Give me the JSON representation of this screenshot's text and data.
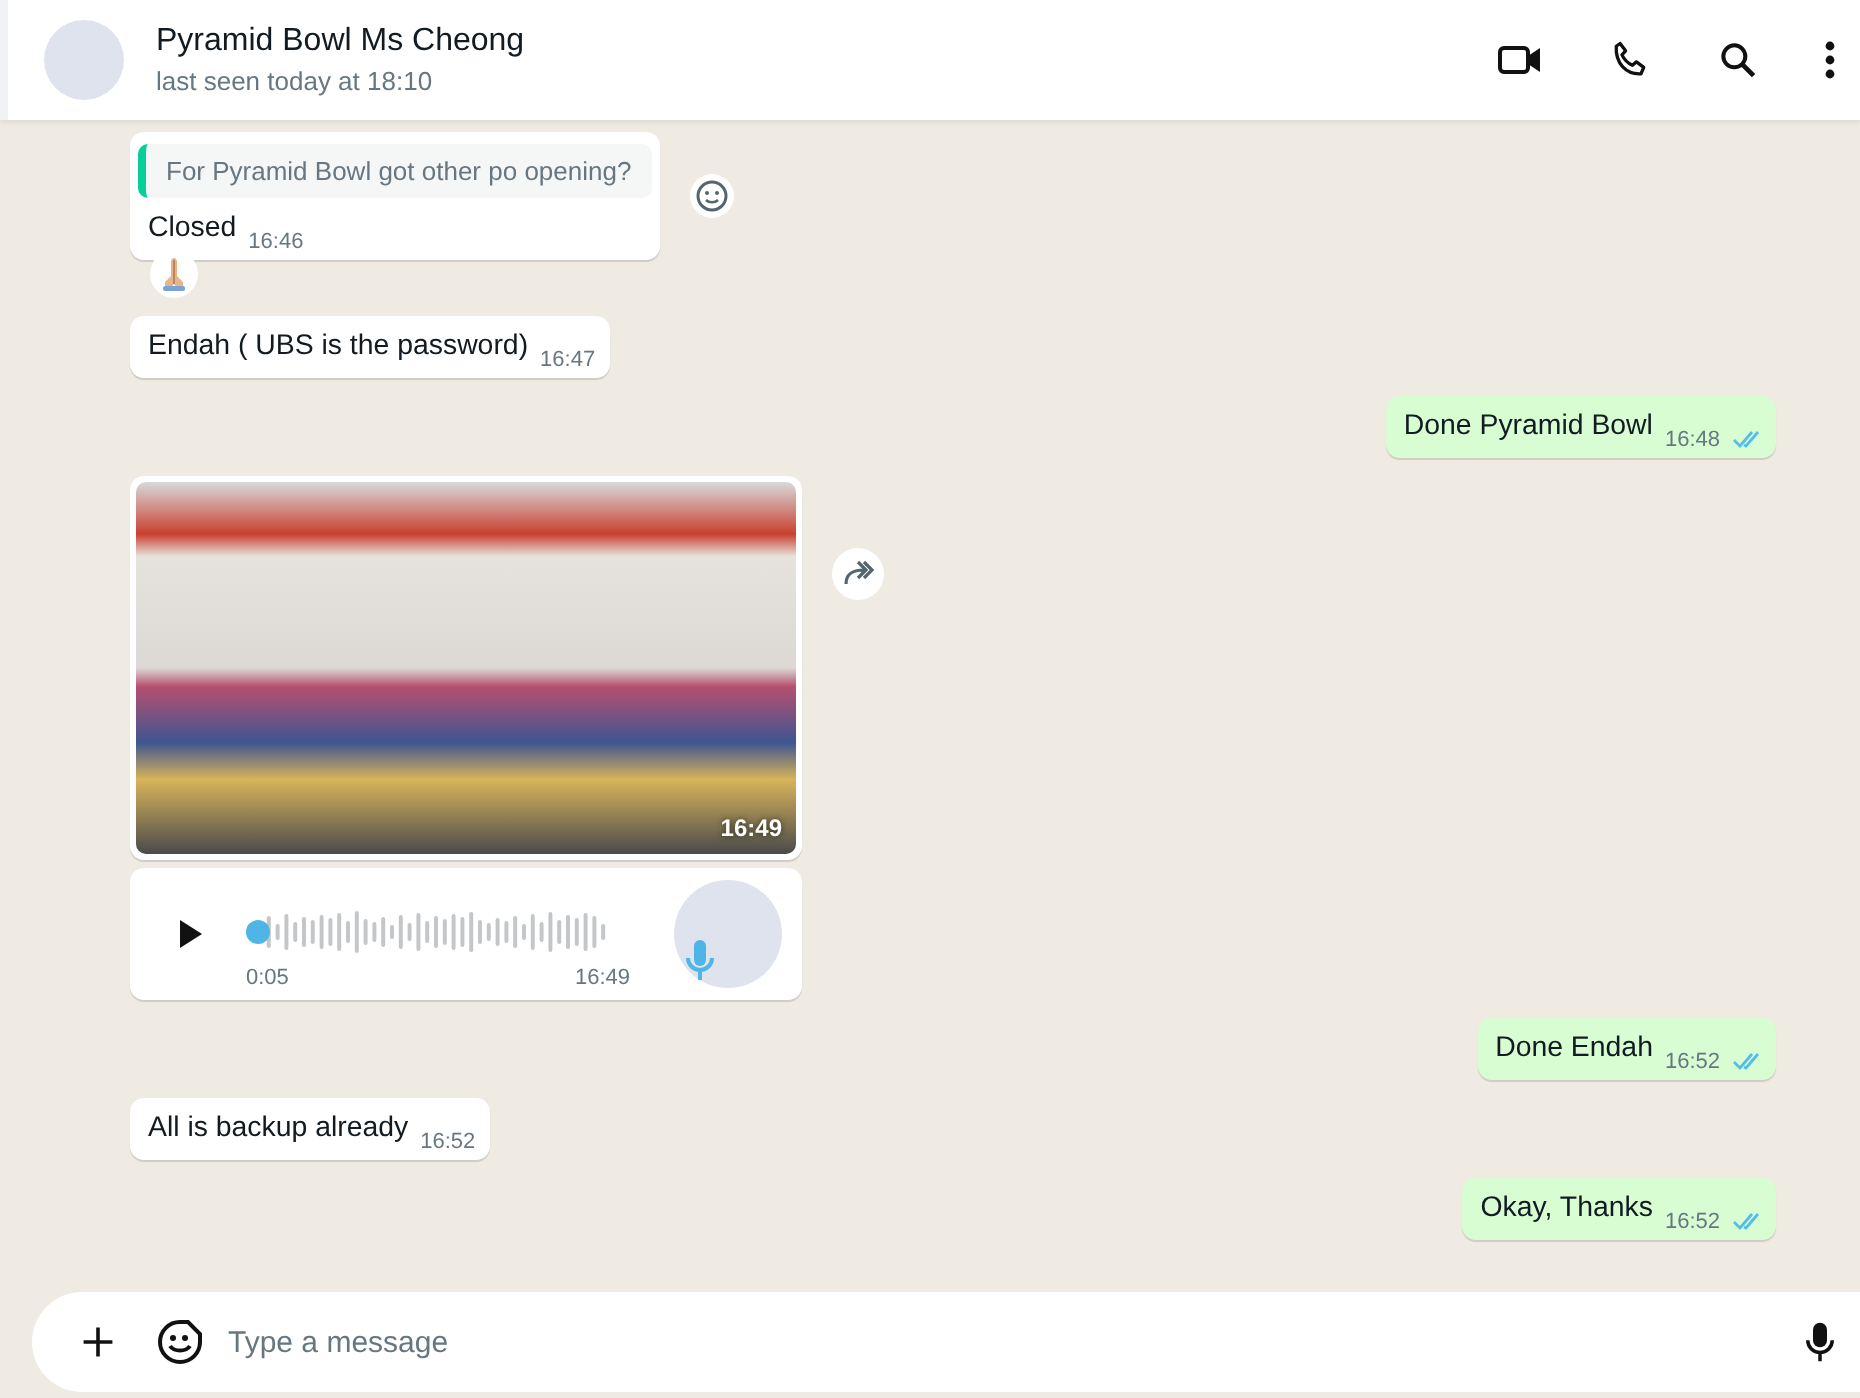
{
  "header": {
    "contact_name": "Pyramid Bowl Ms Cheong",
    "status": "last seen today at 18:10"
  },
  "messages": [
    {
      "kind": "text",
      "outgoing": false,
      "quote": "For Pyramid Bowl got other po opening?",
      "text": "Closed",
      "time": "16:46",
      "reacted": true
    },
    {
      "kind": "text",
      "outgoing": false,
      "text": "Endah ( UBS is the password)",
      "time": "16:47"
    },
    {
      "kind": "text",
      "outgoing": true,
      "text": "Done Pyramid Bowl",
      "time": "16:48",
      "read": true
    },
    {
      "kind": "image",
      "outgoing": false,
      "time": "16:49"
    },
    {
      "kind": "voice",
      "outgoing": false,
      "duration": "0:05",
      "time": "16:49",
      "level": 0
    },
    {
      "kind": "text",
      "outgoing": true,
      "text": "Done Endah",
      "time": "16:52",
      "read": true
    },
    {
      "kind": "text",
      "outgoing": false,
      "text": "All is backup already",
      "time": "16:52"
    },
    {
      "kind": "text",
      "outgoing": true,
      "text": "Okay, Thanks",
      "time": "16:52",
      "read": true
    }
  ],
  "composer": {
    "placeholder": "Type a message"
  }
}
